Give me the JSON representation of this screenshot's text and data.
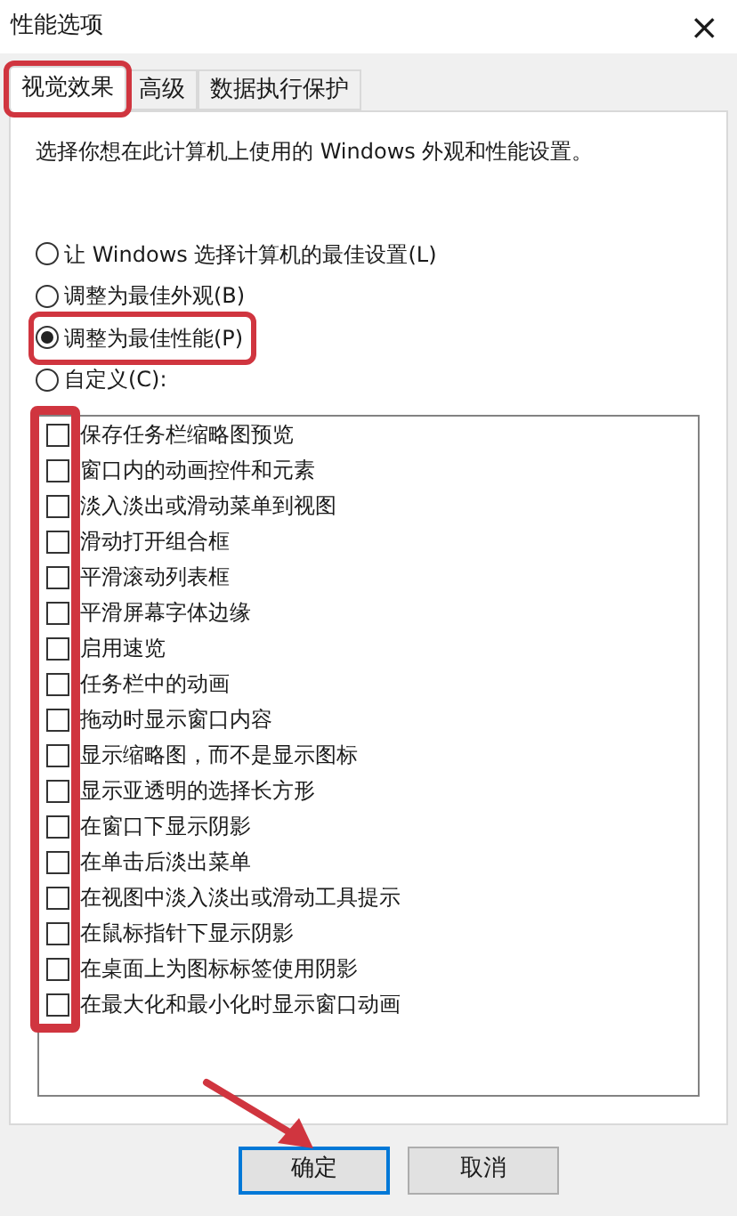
{
  "window": {
    "title": "性能选项",
    "close": "×"
  },
  "tabs": [
    {
      "label": "视觉效果",
      "selected": true,
      "highlighted": true
    },
    {
      "label": "高级",
      "selected": false,
      "highlighted": false
    },
    {
      "label": "数据执行保护",
      "selected": false,
      "highlighted": false
    }
  ],
  "description": "选择你想在此计算机上使用的 Windows 外观和性能设置。",
  "options": [
    {
      "label": "让 Windows 选择计算机的最佳设置(L)",
      "selected": false,
      "highlighted": false
    },
    {
      "label": "调整为最佳外观(B)",
      "selected": false,
      "highlighted": false
    },
    {
      "label": "调整为最佳性能(P)",
      "selected": true,
      "highlighted": true
    },
    {
      "label": "自定义(C):",
      "selected": false,
      "highlighted": false
    }
  ],
  "effects_highlighted": true,
  "effects": [
    {
      "label": "保存任务栏缩略图预览",
      "checked": false
    },
    {
      "label": "窗口内的动画控件和元素",
      "checked": false
    },
    {
      "label": "淡入淡出或滑动菜单到视图",
      "checked": false
    },
    {
      "label": "滑动打开组合框",
      "checked": false
    },
    {
      "label": "平滑滚动列表框",
      "checked": false
    },
    {
      "label": "平滑屏幕字体边缘",
      "checked": false
    },
    {
      "label": "启用速览",
      "checked": false
    },
    {
      "label": "任务栏中的动画",
      "checked": false
    },
    {
      "label": "拖动时显示窗口内容",
      "checked": false
    },
    {
      "label": "显示缩略图，而不是显示图标",
      "checked": false
    },
    {
      "label": "显示亚透明的选择长方形",
      "checked": false
    },
    {
      "label": "在窗口下显示阴影",
      "checked": false
    },
    {
      "label": "在单击后淡出菜单",
      "checked": false
    },
    {
      "label": "在视图中淡入淡出或滑动工具提示",
      "checked": false
    },
    {
      "label": "在鼠标指针下显示阴影",
      "checked": false
    },
    {
      "label": "在桌面上为图标标签使用阴影",
      "checked": false
    },
    {
      "label": "在最大化和最小化时显示窗口动画",
      "checked": false
    }
  ],
  "buttons": [
    {
      "label": "确定",
      "selected": true,
      "highlighted": true
    },
    {
      "label": "取消",
      "selected": false,
      "highlighted": false
    }
  ]
}
